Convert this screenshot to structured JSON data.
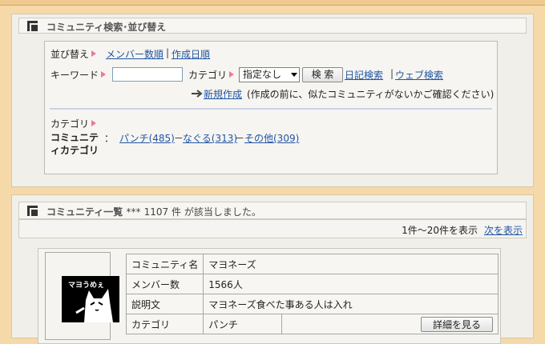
{
  "search_panel": {
    "title": "コミュニティ検索･並び替え",
    "sort_label": "並び替え",
    "sort_links": [
      "メンバー数順",
      "作成日順"
    ],
    "keyword_label": "キーワード",
    "keyword_value": "",
    "category_label": "カテゴリ",
    "category_selected": "指定なし",
    "search_button": "検 索",
    "diary_search": "日記検索",
    "web_search": "ウェブ検索",
    "new_create": "新規作成",
    "new_create_note": "(作成の前に、似たコミュニティがないかご確認ください)",
    "category_heading": "カテゴリ",
    "community_category_label": "コミュニティカテゴリ",
    "categories": [
      "パンチ(485)",
      "なぐる(313)",
      "その他(309)"
    ]
  },
  "list_panel": {
    "title": "コミュニティ一覧",
    "stars": "***",
    "result_count": "1107 件 が該当しました。",
    "range": "1件～20件を表示",
    "next_link": "次を表示",
    "item": {
      "thumb_text": "マヨうめぇ",
      "rows": [
        {
          "label": "コミュニティ名",
          "value": "マヨネーズ"
        },
        {
          "label": "メンバー数",
          "value": "1566人"
        },
        {
          "label": "説明文",
          "value": "マヨネーズ食べた事ある人は入れ"
        },
        {
          "label": "カテゴリ",
          "value": "パンチ"
        }
      ],
      "detail_button": "詳細を見る"
    }
  },
  "colors": {
    "page_bg": "#f5d9a8",
    "link": "#2255a4",
    "arrow": "#e97a9a"
  }
}
